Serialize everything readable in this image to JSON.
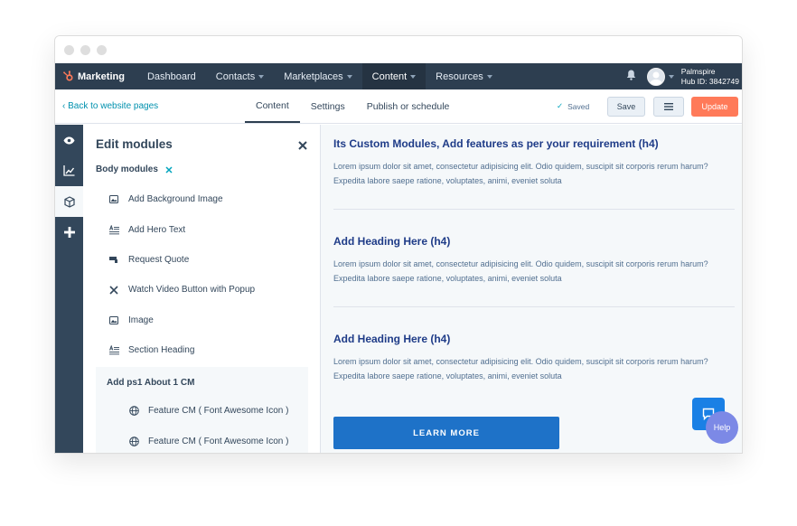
{
  "nav": {
    "brand": "Marketing",
    "items": [
      {
        "label": "Dashboard",
        "dropdown": false
      },
      {
        "label": "Contacts",
        "dropdown": true
      },
      {
        "label": "Marketplaces",
        "dropdown": true
      },
      {
        "label": "Content",
        "dropdown": true,
        "active": true
      },
      {
        "label": "Resources",
        "dropdown": true
      }
    ],
    "account_name": "Palmspire",
    "account_hub": "Hub ID: 3842749"
  },
  "subbar": {
    "back_label": "‹  Back to website pages",
    "tabs": [
      {
        "label": "Content",
        "active": true
      },
      {
        "label": "Settings",
        "active": false
      },
      {
        "label": "Publish or schedule",
        "active": false
      }
    ],
    "saved_check": "✓",
    "saved_label": "Saved",
    "save_label": "Save",
    "update_label": "Update"
  },
  "panel": {
    "title": "Edit modules",
    "section_label": "Body modules",
    "modules": [
      {
        "label": "Add Background Image",
        "icon": "image-icon"
      },
      {
        "label": "Add Hero Text",
        "icon": "text-icon"
      },
      {
        "label": "Request Quote",
        "icon": "form-icon"
      },
      {
        "label": "Watch Video Button with Popup",
        "icon": "close-icon"
      },
      {
        "label": "Image",
        "icon": "image-icon"
      },
      {
        "label": "Section Heading",
        "icon": "text-icon"
      }
    ],
    "group": {
      "title": "Add ps1 About 1 CM",
      "items": [
        {
          "label": "Feature CM ( Font Awesome Icon )",
          "icon": "globe-icon"
        },
        {
          "label": "Feature CM ( Font Awesome Icon )",
          "icon": "globe-icon"
        }
      ]
    }
  },
  "preview": {
    "sections": [
      {
        "heading": "Its Custom Modules, Add features as per your requirement (h4)",
        "text": "Lorem ipsum dolor sit amet, consectetur adipisicing elit. Odio quidem, suscipit sit corporis rerum harum? Expedita labore saepe ratione, voluptates, animi, eveniet soluta"
      },
      {
        "heading": "Add Heading Here (h4)",
        "text": "Lorem ipsum dolor sit amet, consectetur adipisicing elit. Odio quidem, suscipit sit corporis rerum harum? Expedita labore saepe ratione, voluptates, animi, eveniet soluta"
      },
      {
        "heading": "Add Heading Here (h4)",
        "text": "Lorem ipsum dolor sit amet, consectetur adipisicing elit. Odio quidem, suscipit sit corporis rerum harum? Expedita labore saepe ratione, voluptates, animi, eveniet soluta"
      }
    ],
    "button_label": "LEARN MORE",
    "help_label": "Help"
  },
  "colors": {
    "nav_bg": "#2d3e50",
    "accent_orange": "#ff7a59",
    "link_teal": "#0091ae",
    "heading_blue": "#1f3c88",
    "button_blue": "#1e72c8",
    "help_purple": "#7c89e6"
  }
}
